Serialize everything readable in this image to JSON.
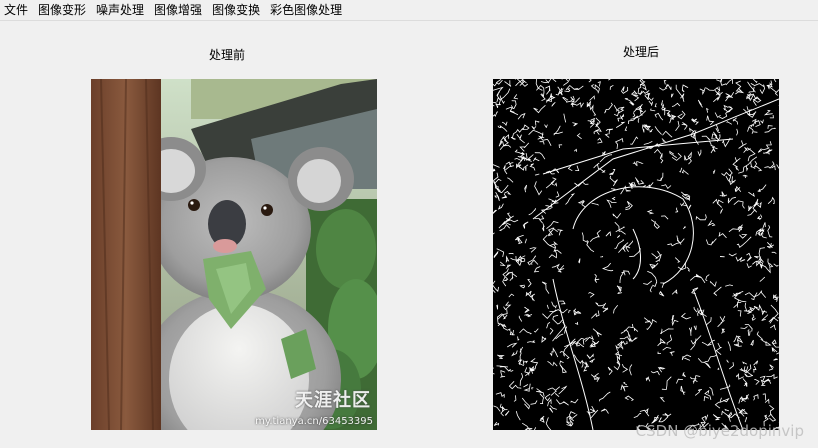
{
  "menu": {
    "items": [
      {
        "label": "文件"
      },
      {
        "label": "图像变形"
      },
      {
        "label": "噪声处理"
      },
      {
        "label": "图像增强"
      },
      {
        "label": "图像变换"
      },
      {
        "label": "彩色图像处理"
      }
    ]
  },
  "panels": {
    "before": {
      "caption": "处理前"
    },
    "after": {
      "caption": "处理后"
    }
  },
  "watermarks": {
    "image_logo": "天涯社区",
    "image_url": "my.tianya.cn/63453395",
    "csdn": "CSDN @biye2dopinvip"
  },
  "colors": {
    "background": "#f0f0f0",
    "edge_background": "#000000",
    "edge_lines": "#ffffff"
  }
}
